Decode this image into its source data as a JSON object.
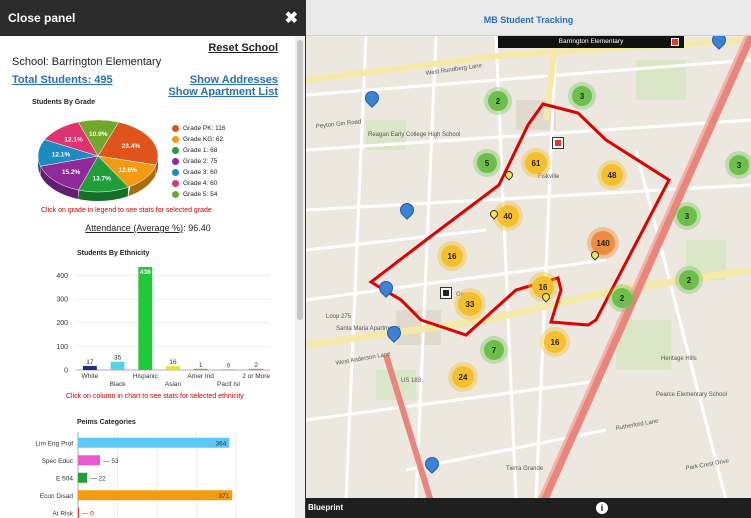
{
  "panel": {
    "header_title": "Close panel",
    "close_glyph": "✖",
    "school_label": "School: Barrington Elementary",
    "reset_label": "Reset School",
    "total_students_label": "Total Students: 495",
    "show_addresses_label": "Show Addresses",
    "show_apartment_list_label": "Show Apartment List",
    "grade_chart_title": "Students By Grade",
    "grade_chart_note": "Click on grade in legend to see stats for selected grade",
    "attendance_label": "Attendance (Average %)",
    "attendance_value": ": 96.40",
    "ethnicity_chart_title": "Students By Ethnicity",
    "ethnicity_chart_note": "Click on column in chart to see stats for selected ethnicity",
    "peims_chart_title": "Peims Categories"
  },
  "chart_data": [
    {
      "type": "pie",
      "title": "Students By Grade",
      "slices": [
        {
          "label": "Grade PK: 116",
          "value": 116,
          "pct_label": "23.4%",
          "color": "#e0541b"
        },
        {
          "label": "Grade KG: 62",
          "value": 62,
          "pct_label": "12.6%",
          "color": "#f39c12"
        },
        {
          "label": "Grade 1: 68",
          "value": 68,
          "pct_label": "13.7%",
          "color": "#1f9e3a"
        },
        {
          "label": "Grade 2: 75",
          "value": 75,
          "pct_label": "15.2%",
          "color": "#8e2a9c"
        },
        {
          "label": "Grade 3: 60",
          "value": 60,
          "pct_label": "12.1%",
          "color": "#1b8bc2"
        },
        {
          "label": "Grade 4: 60",
          "value": 60,
          "pct_label": "12.1%",
          "color": "#e0336f"
        },
        {
          "label": "Grade 5: 54",
          "value": 54,
          "pct_label": "10.9%",
          "color": "#6fa82a"
        }
      ]
    },
    {
      "type": "bar",
      "title": "Students By Ethnicity",
      "categories": [
        "White",
        "Black",
        "Hispanic",
        "Asian",
        "Amer Ind",
        "Pacif Isl",
        "2 or More"
      ],
      "values": [
        17,
        35,
        436,
        16,
        1,
        0,
        2
      ],
      "colors": [
        "#1d2b8f",
        "#55d3e8",
        "#22c936",
        "#e6e61e",
        "#c08a1e",
        "#9a9a9a",
        "#e655d8"
      ],
      "ylim": [
        0,
        440
      ],
      "yticks": [
        0,
        100,
        200,
        300,
        400
      ]
    },
    {
      "type": "bar",
      "orientation": "horizontal",
      "title": "Peims Categories",
      "categories": [
        "Lim Eng Prof",
        "Spec Educ",
        "E 504",
        "Econ Disad",
        "At Risk"
      ],
      "values": [
        364,
        53,
        22,
        371,
        0
      ],
      "colors": [
        "#5bc8f5",
        "#e85bd0",
        "#1f9e3a",
        "#f39c12",
        "#d40000"
      ],
      "xlim": [
        0,
        380
      ]
    }
  ],
  "map": {
    "header_title": "MB Student Tracking",
    "school_tag": "Barrington Elementary",
    "footer_label": "Blueprint",
    "info_glyph": "i",
    "streets": [
      "West Rundberg Lane",
      "Peyton Gin Road",
      "Loop 275",
      "West Anderson Lane",
      "US 183",
      "Fiskville",
      "Georg",
      "Heritage Hills",
      "Rutherford Lane",
      "Park Crest Drive",
      "Santa Maria Apartments",
      "Pearce Elementary School",
      "Reagan Early College High School",
      "Tierra Grande"
    ],
    "clusters": [
      {
        "label": "2",
        "kind": "green"
      },
      {
        "label": "3",
        "kind": "green"
      },
      {
        "label": "5",
        "kind": "green"
      },
      {
        "label": "61",
        "kind": "yellow"
      },
      {
        "label": "48",
        "kind": "yellow"
      },
      {
        "label": "40",
        "kind": "yellow"
      },
      {
        "label": "140",
        "kind": "orange"
      },
      {
        "label": "16",
        "kind": "yellow"
      },
      {
        "label": "16",
        "kind": "yellow"
      },
      {
        "label": "33",
        "kind": "yellow"
      },
      {
        "label": "3",
        "kind": "green"
      },
      {
        "label": "3",
        "kind": "green"
      },
      {
        "label": "2",
        "kind": "green"
      },
      {
        "label": "2",
        "kind": "green"
      },
      {
        "label": "7",
        "kind": "green"
      },
      {
        "label": "24",
        "kind": "yellow"
      },
      {
        "label": "16",
        "kind": "yellow"
      }
    ]
  }
}
